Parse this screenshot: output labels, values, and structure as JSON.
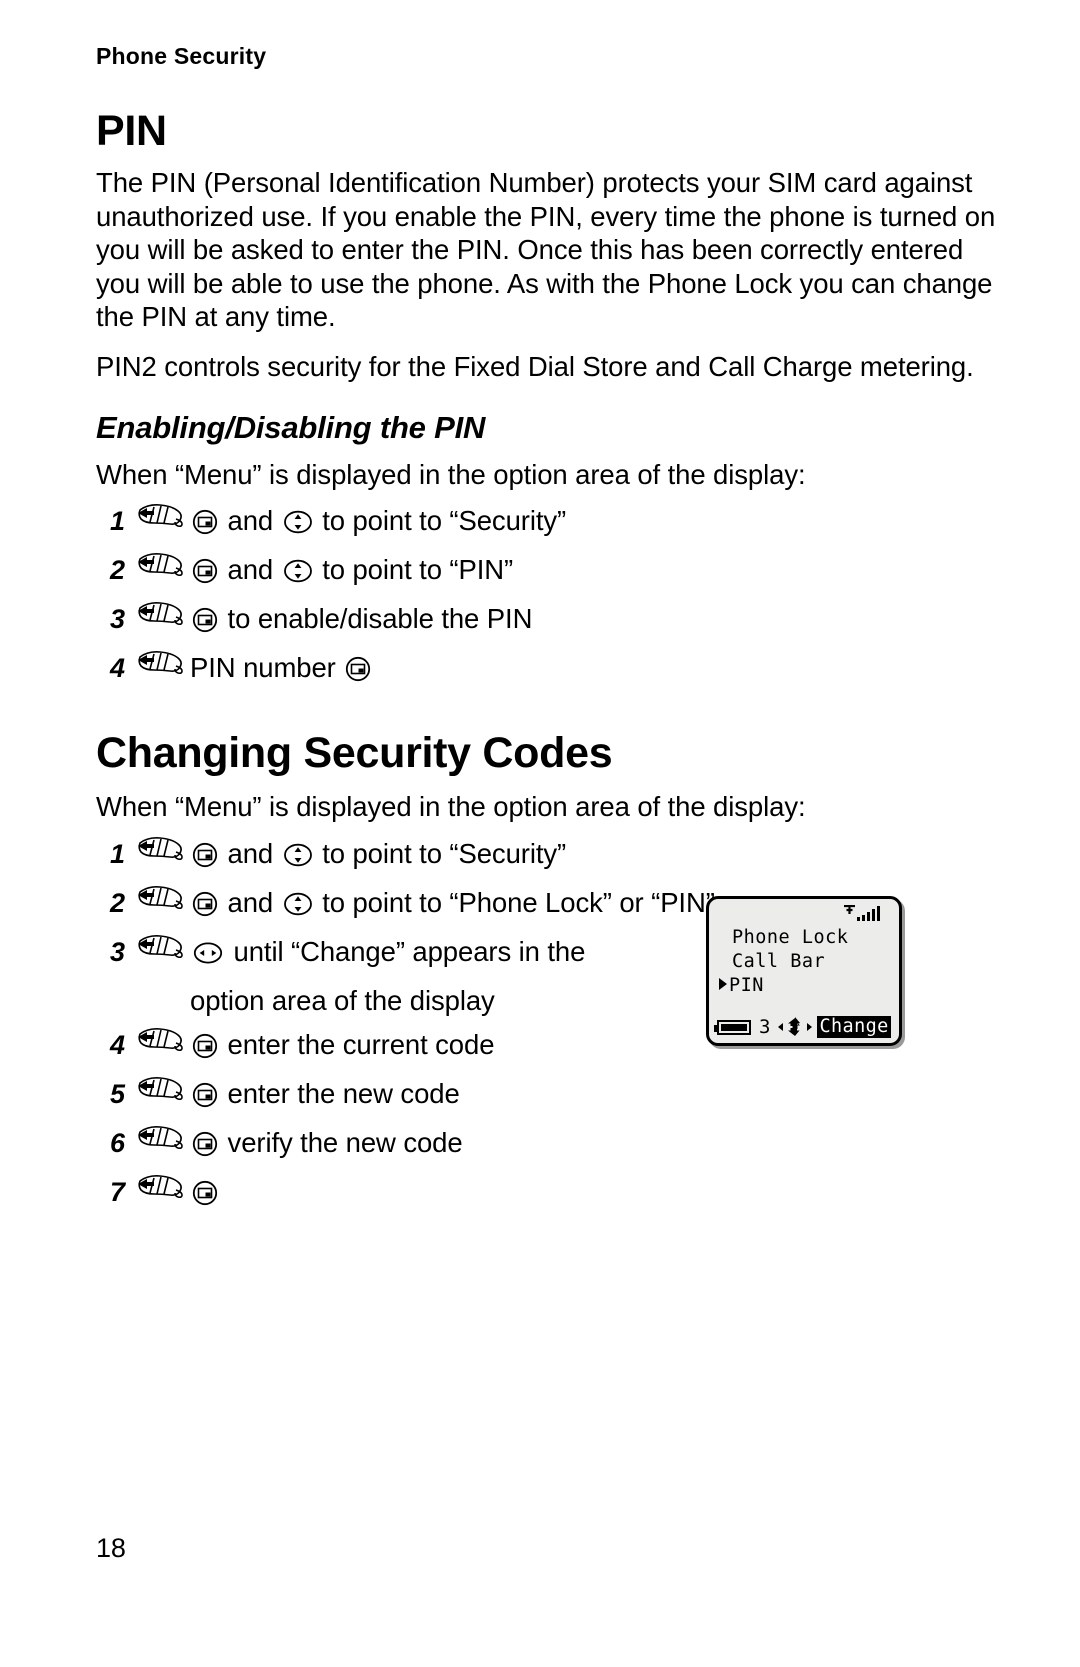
{
  "page": {
    "running_head": "Phone Security",
    "page_number": "18"
  },
  "sections": [
    {
      "heading": "PIN",
      "paragraphs": [
        "The PIN (Personal Identification Number) protects your SIM card against unauthorized use. If you enable the PIN, every time the phone is turned on you will be asked to enter the PIN. Once this has been correctly entered you will be able to use the phone. As with the Phone Lock you can change the PIN at any time.",
        "PIN2 controls security for the Fixed Dial Store and Call Charge metering."
      ],
      "subheading": "Enabling/Disabling the PIN",
      "intro": "When “Menu” is displayed in the option area of the display:",
      "steps": [
        {
          "num": "1",
          "parts": [
            "select-icon",
            " and ",
            "updown-icon",
            " to point to “Security”"
          ]
        },
        {
          "num": "2",
          "parts": [
            "select-icon",
            " and ",
            "updown-icon",
            " to point to “PIN”"
          ]
        },
        {
          "num": "3",
          "parts": [
            "select-icon",
            " to enable/disable the PIN"
          ]
        },
        {
          "num": "4",
          "parts": [
            "PIN number ",
            "select-icon"
          ]
        }
      ]
    },
    {
      "heading": "Changing Security Codes",
      "intro": "When “Menu” is displayed in the option area of the display:",
      "steps": [
        {
          "num": "1",
          "parts": [
            "select-icon",
            " and ",
            "updown-icon",
            " to point to “Security”"
          ]
        },
        {
          "num": "2",
          "parts": [
            "select-icon",
            " and ",
            "updown-icon",
            " to point to “Phone Lock” or “PIN”"
          ]
        },
        {
          "num": "3",
          "parts": [
            "leftright-icon",
            " until “Change” appears in the"
          ],
          "cont": "option area of the display"
        },
        {
          "num": "4",
          "parts": [
            "select-icon",
            " enter the current code"
          ]
        },
        {
          "num": "5",
          "parts": [
            "select-icon",
            " enter the new code"
          ]
        },
        {
          "num": "6",
          "parts": [
            "select-icon",
            " verify the new code"
          ]
        },
        {
          "num": "7",
          "parts": [
            "select-icon"
          ]
        }
      ]
    }
  ],
  "step_text": {
    "s1_a": " and ",
    "s1_b": " to point to “Security”",
    "s2_b": " to point to “PIN”",
    "s3_b": " to enable/disable the PIN",
    "s4_a": "PIN number ",
    "c2_b": " to point to “Phone Lock” or “PIN”",
    "c3_b": " until “Change” appears in the",
    "c3_cont": "option area of the display",
    "c4_b": " enter the current code",
    "c5_b": " enter the new code",
    "c6_b": " verify the new code"
  },
  "phone_display": {
    "menu_items": [
      {
        "label": "Phone Lock",
        "selected": false
      },
      {
        "label": "Call Bar",
        "selected": false
      },
      {
        "label": "PIN",
        "selected": true
      }
    ],
    "battery_level": "3",
    "softkey_label": "Change",
    "signal_icon": "signal-strength-icon",
    "navpad_icon": "navigation-pad-icon",
    "battery_icon": "battery-icon"
  },
  "colors": {
    "ink": "#000000",
    "paper": "#ffffff",
    "screen_bg": "#ececeb",
    "screen_shadow": "#9a9a9a"
  }
}
